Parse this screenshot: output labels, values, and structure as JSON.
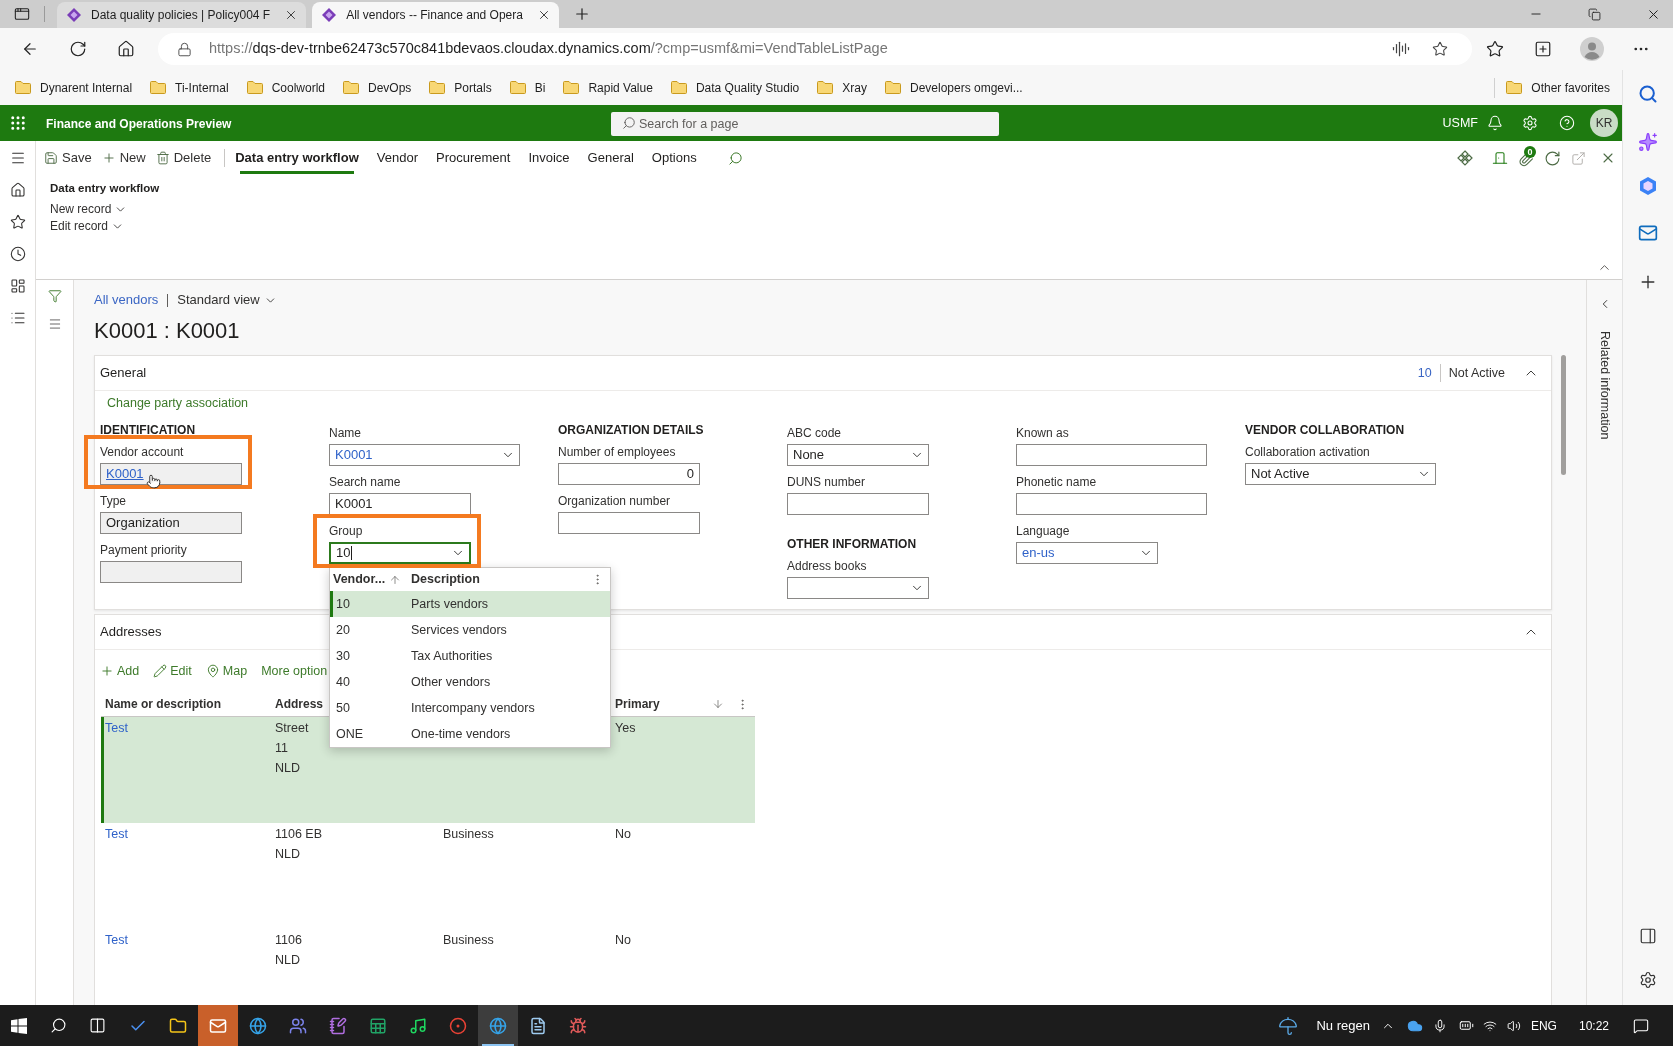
{
  "browser": {
    "tabs": [
      {
        "title": "Data quality policies | Policy004 F",
        "selected": false
      },
      {
        "title": "All vendors -- Finance and Opera",
        "selected": true
      }
    ],
    "address": {
      "scheme": "https://",
      "host": "dqs-dev-trnbe62473c570c841bdevaos.cloudax.dynamics.com",
      "path": "/?cmp=usmf&mi=VendTableListPage"
    },
    "favorites": [
      "Dynarent Internal",
      "Ti-Internal",
      "Coolworld",
      "DevOps",
      "Portals",
      "Bi",
      "Rapid Value",
      "Data Quality Studio",
      "Xray",
      "Developers omgevi..."
    ],
    "other_favorites": "Other favorites"
  },
  "app": {
    "title": "Finance and Operations Preview",
    "search": {
      "placeholder": "Search for a page"
    },
    "company": "USMF",
    "user_initials": "KR"
  },
  "action_pane": {
    "commands": [
      "Save",
      "New",
      "Delete"
    ],
    "tabs": [
      {
        "label": "Data entry workflow",
        "selected": true
      },
      {
        "label": "Vendor",
        "selected": false
      },
      {
        "label": "Procurement",
        "selected": false
      },
      {
        "label": "Invoice",
        "selected": false
      },
      {
        "label": "General",
        "selected": false
      },
      {
        "label": "Options",
        "selected": false
      }
    ],
    "attachments_count": "0",
    "group": {
      "title": "Data entry workflow",
      "menus": [
        "New record",
        "Edit record"
      ]
    }
  },
  "breadcrumb": {
    "link": "All vendors",
    "view": "Standard view"
  },
  "record_title": "K0001 : K0001",
  "general": {
    "title": "General",
    "expanded": true,
    "summary": [
      {
        "text": "10",
        "kind": "link"
      },
      {
        "text": "Not Active",
        "kind": "plain"
      }
    ],
    "link": "Change party association",
    "columns": [
      {
        "sections": [
          {
            "heading": "IDENTIFICATION",
            "fields": [
              {
                "label": "Vendor account",
                "kind": "link",
                "value": "K0001",
                "read_only": true,
                "highlighted": true
              },
              {
                "label": "Type",
                "kind": "text",
                "value": "Organization",
                "read_only": true,
                "highlighted": false
              },
              {
                "label": "Payment priority",
                "kind": "text",
                "read_only": true,
                "highlighted": false
              }
            ]
          }
        ]
      },
      {
        "sections": [
          {
            "fields": [
              {
                "label": "Name",
                "kind": "lookup",
                "value": "K0001",
                "read_only": false,
                "highlighted": false,
                "open": false
              },
              {
                "label": "Search name",
                "kind": "text",
                "value": "K0001",
                "read_only": false,
                "highlighted": false
              },
              {
                "label": "Group",
                "kind": "dropdown",
                "value": "10",
                "read_only": false,
                "highlighted": true,
                "open": true,
                "lookup": {
                  "columns": [
                    {
                      "label": "Vendor...",
                      "sorted": true,
                      "descending": false
                    },
                    {
                      "label": "Description",
                      "sorted": false
                    }
                  ],
                  "rows": [
                    {
                      "code": "10",
                      "description": "Parts vendors",
                      "selected": true
                    },
                    {
                      "code": "20",
                      "description": "Services vendors",
                      "selected": false
                    },
                    {
                      "code": "30",
                      "description": "Tax Authorities",
                      "selected": false
                    },
                    {
                      "code": "40",
                      "description": "Other vendors",
                      "selected": false
                    },
                    {
                      "code": "50",
                      "description": "Intercompany vendors",
                      "selected": false
                    },
                    {
                      "code": "ONE",
                      "description": "One-time vendors",
                      "selected": false
                    }
                  ]
                }
              }
            ]
          }
        ]
      },
      {
        "sections": [
          {
            "heading": "ORGANIZATION DETAILS",
            "fields": [
              {
                "label": "Number of employees",
                "kind": "number",
                "value": "0",
                "read_only": false,
                "highlighted": false
              },
              {
                "label": "Organization number",
                "kind": "text",
                "read_only": false,
                "highlighted": false
              }
            ]
          }
        ]
      },
      {
        "sections": [
          {
            "fields": [
              {
                "label": "ABC code",
                "kind": "dropdown",
                "value": "None",
                "read_only": false,
                "highlighted": false,
                "open": false
              },
              {
                "label": "DUNS number",
                "kind": "text",
                "read_only": false,
                "highlighted": false
              }
            ]
          },
          {
            "heading": "OTHER INFORMATION",
            "fields": [
              {
                "label": "Address books",
                "kind": "dropdown",
                "read_only": false,
                "highlighted": false,
                "open": false
              }
            ]
          }
        ]
      },
      {
        "sections": [
          {
            "fields": [
              {
                "label": "Known as",
                "kind": "text",
                "read_only": false,
                "highlighted": false
              },
              {
                "label": "Phonetic name",
                "kind": "text",
                "read_only": false,
                "highlighted": false
              },
              {
                "label": "Language",
                "kind": "lookup",
                "value": "en-us",
                "read_only": false,
                "highlighted": false,
                "open": false
              }
            ]
          }
        ]
      },
      {
        "sections": [
          {
            "heading": "VENDOR COLLABORATION",
            "fields": [
              {
                "label": "Collaboration activation",
                "kind": "dropdown",
                "value": "Not Active",
                "read_only": false,
                "highlighted": false,
                "open": false
              }
            ]
          }
        ]
      }
    ]
  },
  "addresses": {
    "title": "Addresses",
    "expanded": true,
    "toolbar": [
      "Add",
      "Edit",
      "Map",
      "More option"
    ],
    "columns": {
      "name": {
        "label": "Name or description",
        "sorted": false
      },
      "address": {
        "label": "Address",
        "sorted": false
      },
      "primary": {
        "label": "Primary",
        "sorted": true,
        "descending": true
      }
    },
    "rows": [
      {
        "name": "Test",
        "address": "Street\n11\nNLD",
        "primary": "Yes",
        "selected": true
      },
      {
        "name": "Test",
        "address": "1106 EB\nNLD",
        "column_3": "Business",
        "primary": "No",
        "selected": false
      },
      {
        "name": "Test",
        "address": "1106\nNLD",
        "column_3": "Business",
        "primary": "No",
        "selected": false
      }
    ]
  },
  "related_pane": {
    "title": "Related information"
  },
  "taskbar": {
    "apps": [
      {
        "selected": false,
        "attention": false
      },
      {
        "selected": false,
        "attention": false
      },
      {
        "selected": false,
        "attention": true
      },
      {
        "selected": false,
        "attention": false
      },
      {
        "selected": false,
        "attention": false
      },
      {
        "selected": false,
        "attention": false
      },
      {
        "selected": false,
        "attention": false
      },
      {
        "selected": false,
        "attention": false
      },
      {
        "selected": false,
        "attention": false
      },
      {
        "selected": true,
        "attention": false
      },
      {
        "selected": false,
        "attention": false
      },
      {
        "selected": false,
        "attention": false
      }
    ],
    "weather": "Nu regen",
    "language": "ENG",
    "time": "10:22"
  }
}
